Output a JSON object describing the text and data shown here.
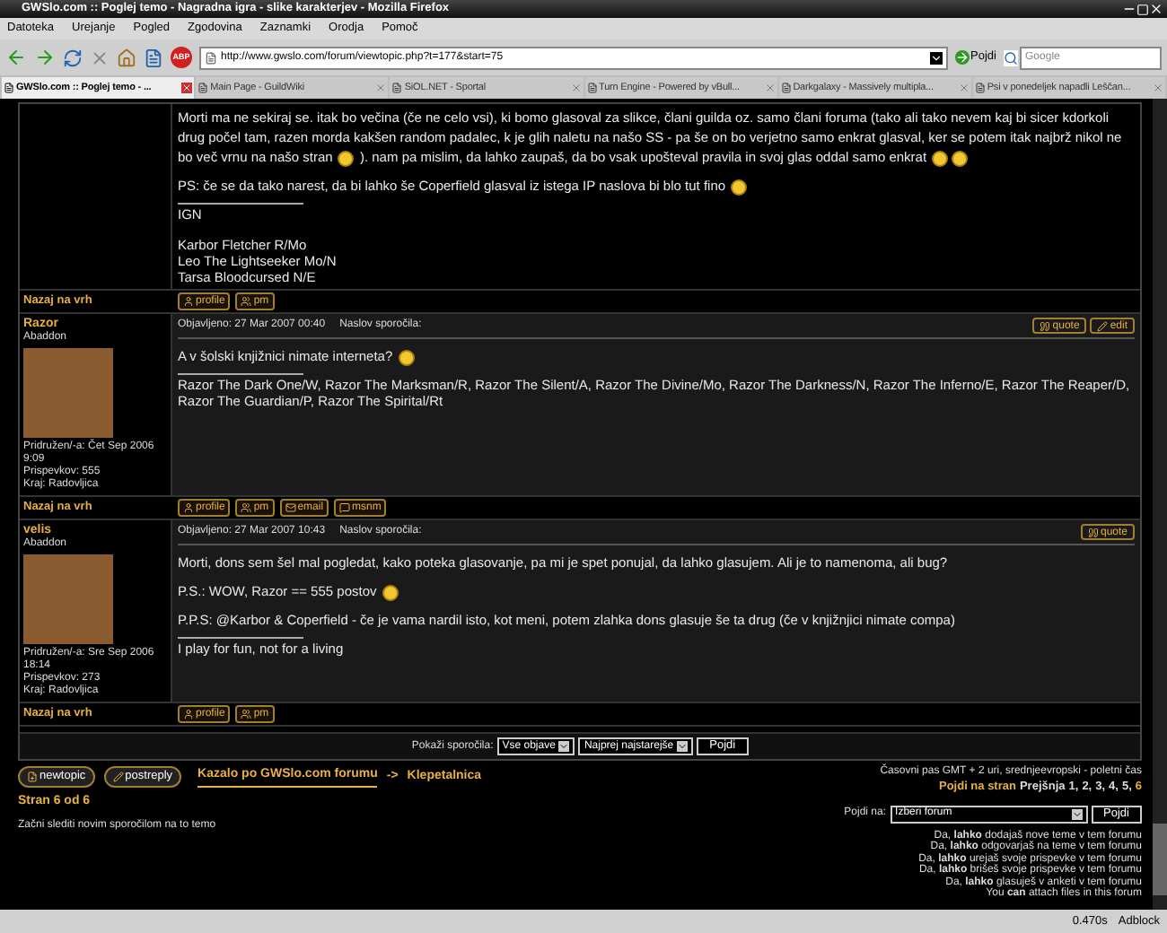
{
  "window": {
    "title": "GWSlo.com :: Poglej temo - Nagradna igra - slike karakterjev - Mozilla Firefox"
  },
  "menu": [
    "Datoteka",
    "Urejanje",
    "Pogled",
    "Zgodovina",
    "Zaznamki",
    "Orodja",
    "Pomoč"
  ],
  "toolbar": {
    "abp": "ABP",
    "url": "http://www.gwslo.com/forum/viewtopic.php?t=177&start=75",
    "go": "Pojdi",
    "search_placeholder": "Google"
  },
  "tabs": [
    {
      "label": "GWSlo.com :: Poglej temo - ...",
      "selected": true
    },
    {
      "label": "Main Page - GuildWiki",
      "selected": false
    },
    {
      "label": "SiOL.NET - Sportal",
      "selected": false
    },
    {
      "label": "Turn Engine - Powered by vBull...",
      "selected": false
    },
    {
      "label": "Darkgalaxy - Massively multipla...",
      "selected": false
    },
    {
      "label": "Psi v ponedeljek napadli Leščan...",
      "selected": false
    }
  ],
  "posts": [
    {
      "body": [
        [
          {
            "kind": "text",
            "text": "Morti ma ne sekiraj se. itak bo večina (če ne celo vsi), ki bomo glasoval za slikce, člani guilda oz. samo člani foruma (tako ali tako nevem kaj bi sicer kdorkoli drug počel tam, razen morda kakšen random padalec, k je glih naletu na našo SS - pa še on bo verjetno samo enkrat glasval, ker se potem itak najbrž nikol ne bo več vrnu na našo stran "
          },
          {
            "kind": "smiley"
          },
          {
            "kind": "text",
            "text": " ). nam pa mislim, da lahko zaupaš, da bo vsak upošteval pravila in svoj glas oddal samo enkrat "
          },
          {
            "kind": "smiley"
          },
          {
            "kind": "smiley"
          }
        ],
        [
          {
            "kind": "text",
            "text": "PS: če se da tako narest, da bi lahko še Coperfield glasval iz istega IP naslova bi blo tut fino "
          },
          {
            "kind": "smiley"
          }
        ]
      ],
      "signature": [
        {
          "kind": "text",
          "text": "IGN"
        },
        {
          "kind": "blank"
        },
        {
          "kind": "text",
          "text": "Karbor Fletcher R/Mo"
        },
        {
          "kind": "text",
          "text": "Leo The Lightseeker Mo/N"
        },
        {
          "kind": "text",
          "text": "Tarsa Bloodcursed N/E"
        }
      ],
      "back_to_top": "Nazaj na vrh",
      "buttons": [
        "profile",
        "pm"
      ]
    },
    {
      "author": "Razor",
      "rank": "Abaddon",
      "details": [
        "Pridružen/-a: Čet Sep 2006 9:09",
        "Prispevkov: 555",
        "Kraj: Radovljica"
      ],
      "date": "Objavljeno: 27 Mar 2007 00:40",
      "subject_label": "Naslov sporočila:",
      "actions": [
        "quote",
        "edit"
      ],
      "body": [
        [
          {
            "kind": "text",
            "text": "A v šolski knjižnici nimate interneta? "
          },
          {
            "kind": "smiley"
          }
        ]
      ],
      "signature": [
        {
          "kind": "text",
          "text": "Razor The Dark One/W, Razor The Marksman/R, Razor The Silent/A, Razor The Divine/Mo, Razor The Darkness/N, Razor The Inferno/E, Razor The Reaper/D, Razor The Guardian/P, Razor The Spirital/Rt"
        }
      ],
      "back_to_top": "Nazaj na vrh",
      "buttons": [
        "profile",
        "pm",
        "email",
        "msnm"
      ]
    },
    {
      "author": "velis",
      "rank": "Abaddon",
      "details": [
        "Pridružen/-a: Sre Sep 2006 18:14",
        "Prispevkov: 273",
        "Kraj: Radovljica"
      ],
      "date": "Objavljeno: 27 Mar 2007 10:43",
      "subject_label": "Naslov sporočila:",
      "actions": [
        "quote"
      ],
      "body": [
        [
          {
            "kind": "text",
            "text": "Morti, dons sem šel mal pogledat, kako poteka glasovanje, pa mi je spet ponujal, da lahko glasujem. Ali je to namenoma, ali bug?"
          }
        ],
        [
          {
            "kind": "text",
            "text": "P.S.: WOW, Razor == 555 postov "
          },
          {
            "kind": "smiley"
          }
        ],
        [
          {
            "kind": "text",
            "text": "P.P.S: @Karbor & Coperfield - če je vama nardil isto, kot meni, potem zlahka dons glasuje še ta drug (če v knjižnjici nimate compa)"
          }
        ]
      ],
      "signature": [
        {
          "kind": "text",
          "text": "I play for fun, not for a living"
        }
      ],
      "back_to_top": "Nazaj na vrh",
      "buttons": [
        "profile",
        "pm"
      ]
    }
  ],
  "sort_bar": {
    "label": "Pokaži sporočila:",
    "filter": "Vse objave",
    "order": "Najprej najstarejše",
    "go": "Pojdi"
  },
  "bottom": {
    "new_topic": "newtopic",
    "post_reply": "postreply",
    "breadcrumb": [
      "Kazalo po GWSlo.com forumu",
      "->",
      "Klepetalnica"
    ],
    "page_of": "Stran 6 od 6",
    "watch": "Začni slediti novim sporočilom na to temo",
    "timezone": "Časovni pas GMT + 2 uri, srednjeevropski - poletni čas",
    "goto_page": "Pojdi na stran",
    "previous": "Prejšnja",
    "pages": [
      {
        "label": "1,",
        "selected": false
      },
      {
        "label": "2,",
        "selected": false
      },
      {
        "label": "3,",
        "selected": false
      },
      {
        "label": "4,",
        "selected": false
      },
      {
        "label": "5,",
        "selected": false
      },
      {
        "label": "6",
        "selected": true
      }
    ],
    "jump_label": "Pojdi na:",
    "jump_select": "Izberi forum",
    "jump_go": "Pojdi",
    "permissions": [
      "Da, **lahko** dodajaš nove teme v tem forumu",
      "Da, **lahko** odgovarjaš na teme v tem forumu",
      "Da, **lahko** urejaš svoje prispevke v tem forumu",
      "Da, **lahko** brišeš svoje prispevke v tem forumu",
      "Da, **lahko** glasuješ v anketi v tem forumu",
      "You **can** attach files in this forum"
    ]
  },
  "status_bar": {
    "timing": "0.470s",
    "adblock": "Adblock"
  }
}
